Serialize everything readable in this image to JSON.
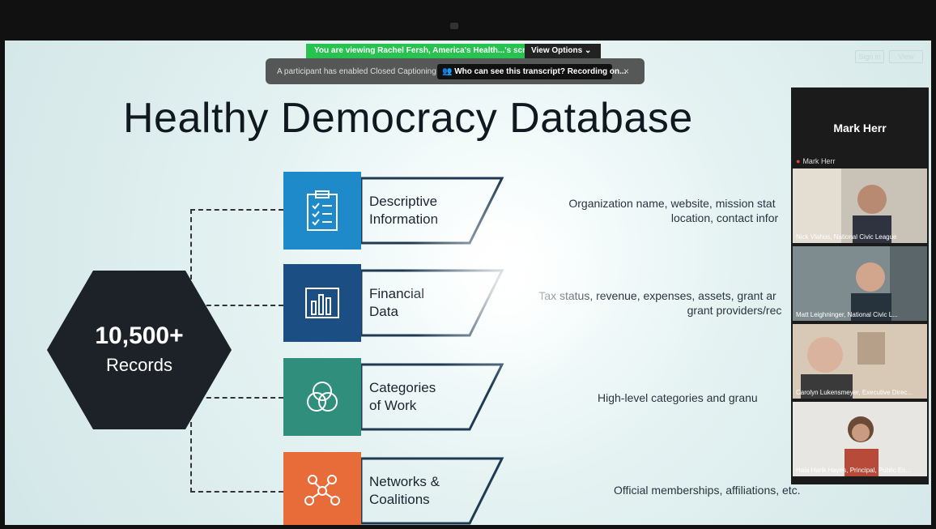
{
  "share_banner": {
    "viewing_text": "You are viewing Rachel Fersh, America's Health...'s screen",
    "view_options_label": "View Options",
    "view_options_chevron": "⌄"
  },
  "captioning_bar": {
    "note": "A participant has enabled Closed Captioning",
    "transcript_button": "Who can see this transcript? Recording on...",
    "close_glyph": "×"
  },
  "top_right": {
    "signin_label": "Sign in",
    "view_label": "View"
  },
  "slide": {
    "title": "Healthy Democracy Database",
    "records_count": "10,500+",
    "records_label": "Records",
    "categories": [
      {
        "icon": "clipboard-checklist-icon",
        "label_line1": "Descriptive",
        "label_line2": "Information",
        "color": "#1f8ac9",
        "desc_line1": "Organization name, website, mission stat",
        "desc_line2": "location, contact infor"
      },
      {
        "icon": "bar-chart-icon",
        "label_line1": "Financial",
        "label_line2": "Data",
        "color": "#1b4f84",
        "desc_line1": "Tax status, revenue, expenses, assets, grant ar",
        "desc_line2": "grant providers/rec"
      },
      {
        "icon": "venn-circles-icon",
        "label_line1": "Categories",
        "label_line2": "of Work",
        "color": "#2f8f7c",
        "desc_line1": "High-level categories and granu",
        "desc_line2": ""
      },
      {
        "icon": "network-nodes-icon",
        "label_line1": "Networks &",
        "label_line2": "Coalitions",
        "color": "#e86b3a",
        "desc_line1": "Official memberships, affiliations, etc.",
        "desc_line2": ""
      }
    ]
  },
  "participants": {
    "active_speaker": "Mark Herr",
    "active_speaker_row": "Mark Herr",
    "tiles": [
      {
        "name": "Nick Vlahos, National Civic League"
      },
      {
        "name": "Matt Leighninger, National Civic L..."
      },
      {
        "name": "Carolyn Lukensmeyer, Executive Direc..."
      },
      {
        "name": "Hala Harik Hayes, Principal, Public En..."
      }
    ]
  },
  "colors": {
    "share_green": "#27c24f",
    "hexagon": "#1d2228",
    "mic_muted": "#e0453b"
  }
}
